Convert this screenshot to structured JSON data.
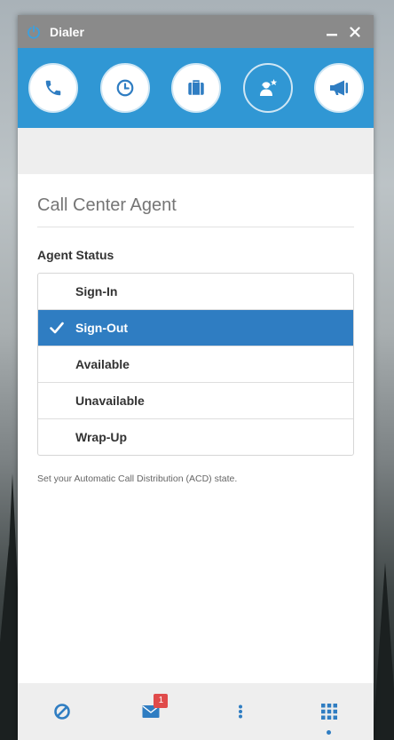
{
  "window": {
    "title": "Dialer",
    "minimize_icon": "minimize-icon",
    "close_icon": "close-icon"
  },
  "toolbar": {
    "items": [
      {
        "name": "phone",
        "icon": "phone-icon"
      },
      {
        "name": "history",
        "icon": "clock-icon"
      },
      {
        "name": "briefcase",
        "icon": "briefcase-icon"
      },
      {
        "name": "agent",
        "icon": "agent-star-icon"
      },
      {
        "name": "broadcast",
        "icon": "megaphone-icon"
      }
    ]
  },
  "main": {
    "heading": "Call Center Agent",
    "section_label": "Agent Status",
    "statuses": [
      {
        "label": "Sign-In",
        "selected": false
      },
      {
        "label": "Sign-Out",
        "selected": true
      },
      {
        "label": "Available",
        "selected": false
      },
      {
        "label": "Unavailable",
        "selected": false
      },
      {
        "label": "Wrap-Up",
        "selected": false
      }
    ],
    "hint": "Set your Automatic Call Distribution (ACD) state."
  },
  "bottombar": {
    "items": [
      {
        "name": "do-not-disturb",
        "icon": "block-icon"
      },
      {
        "name": "messages",
        "icon": "envelope-icon",
        "badge": "1"
      },
      {
        "name": "more",
        "icon": "more-vertical-icon"
      },
      {
        "name": "keypad",
        "icon": "keypad-icon",
        "active": true
      }
    ]
  },
  "colors": {
    "accent": "#3097d4",
    "selected": "#2f7dc2",
    "titlebar": "#8a8a8a",
    "badge": "#e04b4b"
  }
}
